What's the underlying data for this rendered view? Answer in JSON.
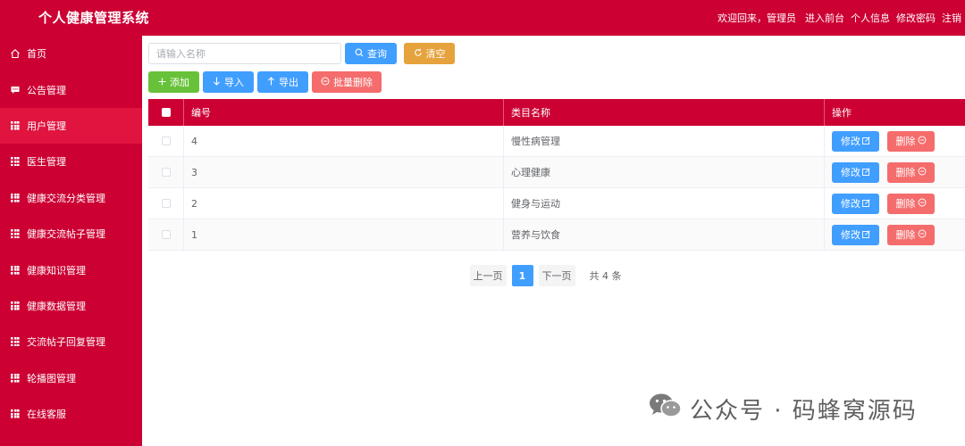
{
  "header": {
    "title": "个人健康管理系统",
    "welcome": "欢迎回来，管理员",
    "links": [
      "进入前台",
      "个人信息",
      "修改密码",
      "注销"
    ]
  },
  "sidebar": {
    "items": [
      {
        "label": "首页",
        "icon": "home-icon"
      },
      {
        "label": "公告管理",
        "icon": "message-icon"
      },
      {
        "label": "用户管理",
        "icon": "grid-icon"
      },
      {
        "label": "医生管理",
        "icon": "grid-icon"
      },
      {
        "label": "健康交流分类管理",
        "icon": "grid-icon"
      },
      {
        "label": "健康交流帖子管理",
        "icon": "grid-icon"
      },
      {
        "label": "健康知识管理",
        "icon": "grid-icon"
      },
      {
        "label": "健康数据管理",
        "icon": "grid-icon"
      },
      {
        "label": "交流帖子回复管理",
        "icon": "grid-icon"
      },
      {
        "label": "轮播图管理",
        "icon": "grid-icon"
      },
      {
        "label": "在线客服",
        "icon": "grid-icon"
      }
    ],
    "active_index": 2
  },
  "search": {
    "placeholder": "请输入名称",
    "value": "",
    "query_label": "查询",
    "clear_label": "清空"
  },
  "toolbar": {
    "add_label": "添加",
    "import_label": "导入",
    "export_label": "导出",
    "batch_delete_label": "批量删除"
  },
  "table": {
    "headers": {
      "id": "编号",
      "name": "类目名称",
      "ops": "操作"
    },
    "rows": [
      {
        "id": "4",
        "name": "慢性病管理"
      },
      {
        "id": "3",
        "name": "心理健康"
      },
      {
        "id": "2",
        "name": "健身与运动"
      },
      {
        "id": "1",
        "name": "营养与饮食"
      }
    ],
    "edit_label": "修改",
    "delete_label": "删除"
  },
  "pagination": {
    "prev_label": "上一页",
    "current_page": "1",
    "next_label": "下一页",
    "total_label": "共 4 条"
  },
  "watermark": {
    "text": "公众号 · 码蜂窝源码"
  },
  "colors": {
    "brand": "#cc0033",
    "primary": "#409eff",
    "success": "#67c23a",
    "warning": "#e6a23c",
    "danger": "#f56c6c"
  }
}
